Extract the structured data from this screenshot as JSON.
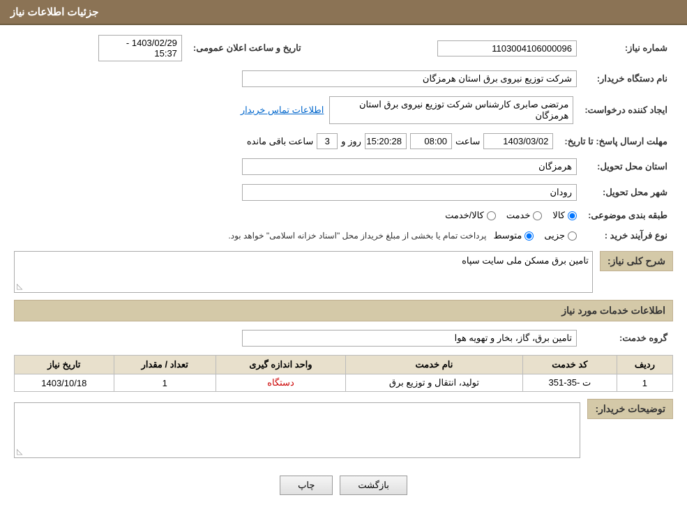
{
  "header": {
    "title": "جزئیات اطلاعات نیاز"
  },
  "sections": {
    "main_info": {
      "label": "جزئیات اطلاعات نیاز",
      "fields": {
        "request_number_label": "شماره نیاز:",
        "request_number_value": "1103004106000096",
        "buyer_org_label": "نام دستگاه خریدار:",
        "buyer_org_value": "شرکت توزیع نیروی برق استان هرمزگان",
        "creator_label": "ایجاد کننده درخواست:",
        "creator_value": "مرتضی صابری کارشناس شرکت توزیع نیروی برق استان هرمزگان",
        "contact_link": "اطلاعات تماس خریدار",
        "announce_date_label": "تاریخ و ساعت اعلان عمومی:",
        "announce_date_value": "1403/02/29 - 15:37",
        "deadline_label": "مهلت ارسال پاسخ: تا تاریخ:",
        "deadline_date": "1403/03/02",
        "deadline_time_label": "ساعت",
        "deadline_time": "08:00",
        "deadline_days_label": "روز و",
        "deadline_days": "3",
        "deadline_remaining_label": "ساعت باقی مانده",
        "deadline_remaining": "15:20:28",
        "province_label": "استان محل تحویل:",
        "province_value": "هرمزگان",
        "city_label": "شهر محل تحویل:",
        "city_value": "رودان",
        "category_label": "طبقه بندی موضوعی:",
        "category_options": [
          "کالا",
          "خدمت",
          "کالا/خدمت"
        ],
        "category_selected": "کالا",
        "process_label": "نوع فرآیند خرید :",
        "process_options": [
          "جزیی",
          "متوسط"
        ],
        "process_selected": "متوسط",
        "process_note": "پرداخت تمام یا بخشی از مبلغ خریداز محل \"اسناد خزانه اسلامی\" خواهد بود."
      }
    },
    "general_description": {
      "title": "شرح کلی نیاز:",
      "content": "تامین برق مسکن ملی سایت سپاه"
    },
    "services_info": {
      "title": "اطلاعات خدمات مورد نیاز",
      "service_group_label": "گروه خدمت:",
      "service_group_value": "تامین برق، گاز، بخار و تهویه هوا",
      "table": {
        "columns": [
          "ردیف",
          "کد خدمت",
          "نام خدمت",
          "واحد اندازه گیری",
          "تعداد / مقدار",
          "تاریخ نیاز"
        ],
        "rows": [
          {
            "row_num": "1",
            "service_code": "ت -35-351",
            "service_name": "تولید، انتقال و توزیع برق",
            "unit": "دستگاه",
            "quantity": "1",
            "date": "1403/10/18"
          }
        ]
      }
    },
    "buyer_notes": {
      "title": "توضیحات خریدار:",
      "content": ""
    }
  },
  "buttons": {
    "print_label": "چاپ",
    "back_label": "بازگشت"
  }
}
